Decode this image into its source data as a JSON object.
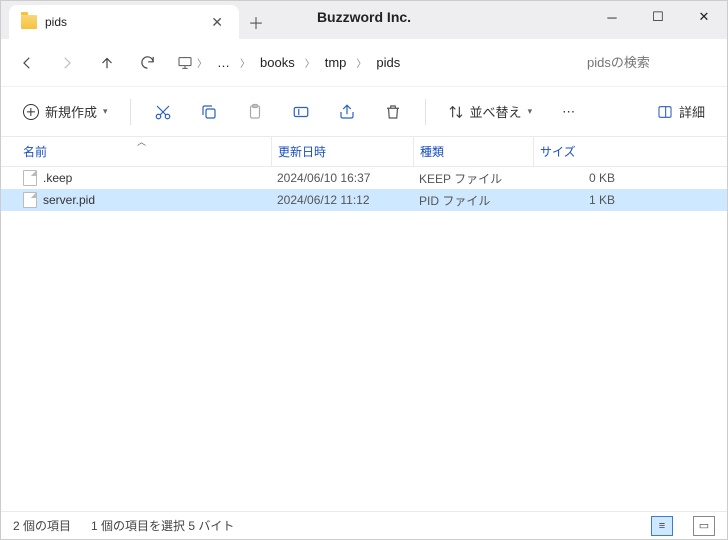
{
  "titlebar": {
    "tab_title": "pids",
    "brand": "Buzzword Inc."
  },
  "breadcrumbs": {
    "ellipsis": "…",
    "segs": [
      "books",
      "tmp",
      "pids"
    ]
  },
  "search": {
    "placeholder": "pidsの検索"
  },
  "toolbar": {
    "new_label": "新規作成",
    "sort_label": "並べ替え",
    "details_label": "詳細"
  },
  "columns": {
    "name": "名前",
    "date": "更新日時",
    "type": "種類",
    "size": "サイズ"
  },
  "files": [
    {
      "name": ".keep",
      "date": "2024/06/10 16:37",
      "type": "KEEP ファイル",
      "size": "0 KB",
      "selected": false
    },
    {
      "name": "server.pid",
      "date": "2024/06/12 11:12",
      "type": "PID ファイル",
      "size": "1 KB",
      "selected": true
    }
  ],
  "status": {
    "count": "2 個の項目",
    "selection": "1 個の項目を選択 5 バイト"
  }
}
